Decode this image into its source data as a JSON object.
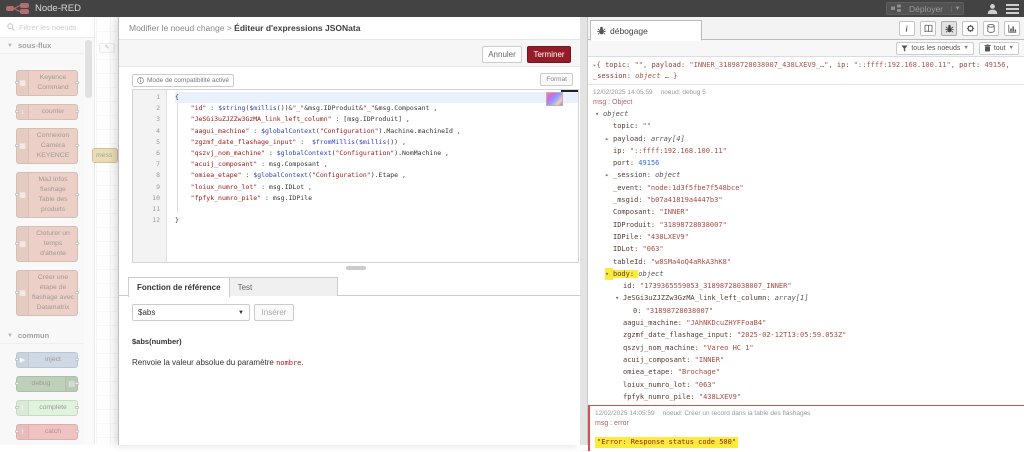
{
  "header": {
    "app_title": "Node-RED",
    "deploy_label": "Déployer"
  },
  "palette": {
    "search_placeholder": "Filtrer les noeuds",
    "categories": [
      {
        "label": "sous-flux",
        "nodes": [
          {
            "lines": [
              "Keyence",
              "Command"
            ],
            "color": "#DDAA99",
            "border": "#b08a7a",
            "icon": "l",
            "glyph": "▦"
          },
          {
            "lines": [
              "counter"
            ],
            "color": "#DDAA99",
            "border": "#b08a7a",
            "icon": "l",
            "glyph": "↕"
          },
          {
            "lines": [
              "Connexion",
              "Caméra",
              "KEYENCE"
            ],
            "color": "#DDAA99",
            "border": "#b08a7a",
            "icon": "l",
            "glyph": "▦"
          },
          {
            "lines": [
              "MàJ infos",
              "flashage",
              "Table des",
              "produits"
            ],
            "color": "#DDAA99",
            "border": "#b08a7a",
            "icon": "l",
            "glyph": "▦"
          },
          {
            "lines": [
              "Cloturer un",
              "temps",
              "d'attente"
            ],
            "color": "#DDAA99",
            "border": "#b08a7a",
            "icon": "l",
            "glyph": "▦"
          },
          {
            "lines": [
              "Créer une",
              "étape de",
              "flashage avec",
              "Datamatrix"
            ],
            "color": "#DDAA99",
            "border": "#b08a7a",
            "icon": "l",
            "glyph": "▦"
          }
        ]
      },
      {
        "label": "commun",
        "nodes": [
          {
            "lines": [
              "inject"
            ],
            "color": "#A6BBCF",
            "border": "#8199ad",
            "icon": "l",
            "glyph": "▶"
          },
          {
            "lines": [
              "debug"
            ],
            "color": "#87A980",
            "border": "#6a8a64",
            "icon": "r",
            "glyph": "▤"
          },
          {
            "lines": [
              "complete"
            ],
            "color": "#C7E9C0",
            "border": "#97bf90",
            "icon": "l",
            "glyph": "!"
          },
          {
            "lines": [
              "catch"
            ],
            "color": "#E49191",
            "border": "#c06e6e",
            "icon": "l",
            "glyph": "!"
          }
        ]
      }
    ]
  },
  "canvas": {
    "node_fragment": "mess"
  },
  "tray": {
    "breadcrumb": "Modifier le noeud change",
    "title": "Éditeur d'expressions JSONata",
    "cancel_label": "Annuler",
    "done_label": "Terminer",
    "compat_label": "Mode de compatibilité activé",
    "format_label": "Format",
    "tabs": [
      "Fonction de référence",
      "Test"
    ],
    "function_select": "$abs",
    "insert_label": "Insérer",
    "signature": "$abs(number)",
    "description_prefix": "Renvoie la valeur absolue du paramètre ",
    "description_code": "nombre",
    "description_suffix": ".",
    "code_lines": [
      [
        {
          "t": "p",
          "s": "{"
        }
      ],
      [
        {
          "t": "p",
          "s": "    "
        },
        {
          "t": "s",
          "s": "\"id\""
        },
        {
          "t": "p",
          "s": " : "
        },
        {
          "t": "f",
          "s": "$string"
        },
        {
          "t": "p",
          "s": "("
        },
        {
          "t": "f",
          "s": "$millis"
        },
        {
          "t": "p",
          "s": "())&"
        },
        {
          "t": "s",
          "s": "\"_\""
        },
        {
          "t": "p",
          "s": "&msg.IDProduit&"
        },
        {
          "t": "s",
          "s": "\"_\""
        },
        {
          "t": "p",
          "s": "&msg.Composant ,"
        }
      ],
      [
        {
          "t": "p",
          "s": "    "
        },
        {
          "t": "s",
          "s": "\"JeSGi3uZJZZw3GzMA_link_left_column\""
        },
        {
          "t": "p",
          "s": " : [msg.IDProduit] ,"
        }
      ],
      [
        {
          "t": "p",
          "s": "    "
        },
        {
          "t": "s",
          "s": "\"aagui_machine\""
        },
        {
          "t": "p",
          "s": " : "
        },
        {
          "t": "f",
          "s": "$globalContext"
        },
        {
          "t": "p",
          "s": "("
        },
        {
          "t": "s",
          "s": "\"Configuration\""
        },
        {
          "t": "p",
          "s": ").Machine.machineId ,"
        }
      ],
      [
        {
          "t": "p",
          "s": "    "
        },
        {
          "t": "s",
          "s": "\"zgzmf_date_flashage_input\""
        },
        {
          "t": "p",
          "s": " :  "
        },
        {
          "t": "f",
          "s": "$fromMillis"
        },
        {
          "t": "p",
          "s": "("
        },
        {
          "t": "f",
          "s": "$millis"
        },
        {
          "t": "p",
          "s": "()) ,"
        }
      ],
      [
        {
          "t": "p",
          "s": "    "
        },
        {
          "t": "s",
          "s": "\"qszvj_nom_machine\""
        },
        {
          "t": "p",
          "s": " : "
        },
        {
          "t": "f",
          "s": "$globalContext"
        },
        {
          "t": "p",
          "s": "("
        },
        {
          "t": "s",
          "s": "\"Configuration\""
        },
        {
          "t": "p",
          "s": ").NomMachine ,"
        }
      ],
      [
        {
          "t": "p",
          "s": "    "
        },
        {
          "t": "s",
          "s": "\"acuij_composant\""
        },
        {
          "t": "p",
          "s": " : msg.Composant ,"
        }
      ],
      [
        {
          "t": "p",
          "s": "    "
        },
        {
          "t": "s",
          "s": "\"omiea_etape\""
        },
        {
          "t": "p",
          "s": " : "
        },
        {
          "t": "f",
          "s": "$globalContext"
        },
        {
          "t": "p",
          "s": "("
        },
        {
          "t": "s",
          "s": "\"Configuration\""
        },
        {
          "t": "p",
          "s": ").Etape ,"
        }
      ],
      [
        {
          "t": "p",
          "s": "    "
        },
        {
          "t": "s",
          "s": "\"loiux_numro_lot\""
        },
        {
          "t": "p",
          "s": " : msg.IDLot ,"
        }
      ],
      [
        {
          "t": "p",
          "s": "    "
        },
        {
          "t": "s",
          "s": "\"fpfyk_numro_pile\""
        },
        {
          "t": "p",
          "s": " : msg.IDPile"
        }
      ],
      [],
      [
        {
          "t": "p",
          "s": "}"
        }
      ]
    ]
  },
  "debug": {
    "tab_label": "débogage",
    "filter_label": "tous les noeuds",
    "clear_label": "tout",
    "preview_lines": [
      [
        {
          "t": "c",
          "s": "▸"
        },
        {
          "t": "p",
          "s": "{ "
        },
        {
          "t": "k",
          "s": "topic: "
        },
        {
          "t": "s",
          "s": "\"\""
        },
        {
          "t": "p",
          "s": ", "
        },
        {
          "t": "k",
          "s": "payload: "
        },
        {
          "t": "s",
          "s": "\"INNER_31898728038007_438LXEV9_…\""
        },
        {
          "t": "p",
          "s": ", "
        },
        {
          "t": "k",
          "s": "ip: "
        },
        {
          "t": "s",
          "s": "\"::ffff:192.168.100.11\""
        },
        {
          "t": "p",
          "s": ", "
        },
        {
          "t": "k",
          "s": "port: "
        },
        {
          "t": "n",
          "s": "49156"
        },
        {
          "t": "p",
          "s": ","
        }
      ],
      [
        {
          "t": "k",
          "s": "_session: "
        },
        {
          "t": "o",
          "s": "object"
        },
        {
          "t": "p",
          "s": " … }"
        }
      ]
    ],
    "msg1_meta_date": "12/02/2025 14:05:59",
    "msg1_meta_node": "noeud: debug 5",
    "msg1_label": "msg : Object",
    "tree": [
      {
        "i": 0,
        "c": "v",
        "k": "",
        "v": "object",
        "t": "type"
      },
      {
        "i": 1,
        "c": "",
        "k": "topic",
        "v": "\"\"",
        "t": "str"
      },
      {
        "i": 1,
        "c": ">",
        "k": "payload",
        "v": "array[4]",
        "t": "type"
      },
      {
        "i": 1,
        "c": "",
        "k": "ip",
        "v": "\"::ffff:192.168.100.11\"",
        "t": "str"
      },
      {
        "i": 1,
        "c": "",
        "k": "port",
        "v": "49156",
        "t": "num"
      },
      {
        "i": 1,
        "c": ">",
        "k": "_session",
        "v": "object",
        "t": "type"
      },
      {
        "i": 1,
        "c": "",
        "k": "_event",
        "v": "\"node:1d3f5fbe7f548bce\"",
        "t": "str"
      },
      {
        "i": 1,
        "c": "",
        "k": "_msgid",
        "v": "\"b07a41819a4447b3\"",
        "t": "str"
      },
      {
        "i": 1,
        "c": "",
        "k": "Composant",
        "v": "\"INNER\"",
        "t": "str"
      },
      {
        "i": 1,
        "c": "",
        "k": "IDProduit",
        "v": "\"31898728038007\"",
        "t": "str"
      },
      {
        "i": 1,
        "c": "",
        "k": "IDPile",
        "v": "\"438LXEV9\"",
        "t": "str"
      },
      {
        "i": 1,
        "c": "",
        "k": "IDLot",
        "v": "\"063\"",
        "t": "str"
      },
      {
        "i": 1,
        "c": "",
        "k": "tableId",
        "v": "\"w8SMa4oQ4aRkA3hK8\"",
        "t": "str"
      },
      {
        "i": 1,
        "c": "v",
        "k": "body",
        "v": "object",
        "t": "type",
        "hl": true
      },
      {
        "i": 2,
        "c": "",
        "k": "id",
        "v": "\"1739365559053_31898728038007_INNER\"",
        "t": "str"
      },
      {
        "i": 2,
        "c": "v",
        "k": "JeSGi3uZJZZw3GzMA_link_left_column",
        "v": "array[1]",
        "t": "type"
      },
      {
        "i": 3,
        "c": "",
        "k": "0",
        "v": "\"31898728038007\"",
        "t": "str"
      },
      {
        "i": 2,
        "c": "",
        "k": "aagui_machine",
        "v": "\"JAhNKDcuZHYFFoaB4\"",
        "t": "str"
      },
      {
        "i": 2,
        "c": "",
        "k": "zgzmf_date_flashage_input",
        "v": "\"2025-02-12T13:05:59.053Z\"",
        "t": "str"
      },
      {
        "i": 2,
        "c": "",
        "k": "qszvj_nom_machine",
        "v": "\"Vareo HC 1\"",
        "t": "str"
      },
      {
        "i": 2,
        "c": "",
        "k": "acuij_composant",
        "v": "\"INNER\"",
        "t": "str"
      },
      {
        "i": 2,
        "c": "",
        "k": "omiea_etape",
        "v": "\"Brochage\"",
        "t": "str"
      },
      {
        "i": 2,
        "c": "",
        "k": "loiux_numro_lot",
        "v": "\"063\"",
        "t": "str"
      },
      {
        "i": 2,
        "c": "",
        "k": "fpfyk_numro_pile",
        "v": "\"438LXEV9\"",
        "t": "str"
      }
    ],
    "msg2_meta_date": "12/02/2025 14:05:59",
    "msg2_meta_node": "noeud: Créer un record dans la table des flashages",
    "msg2_label": "msg : error",
    "error_text": "\"Error: Response status code 500\""
  }
}
